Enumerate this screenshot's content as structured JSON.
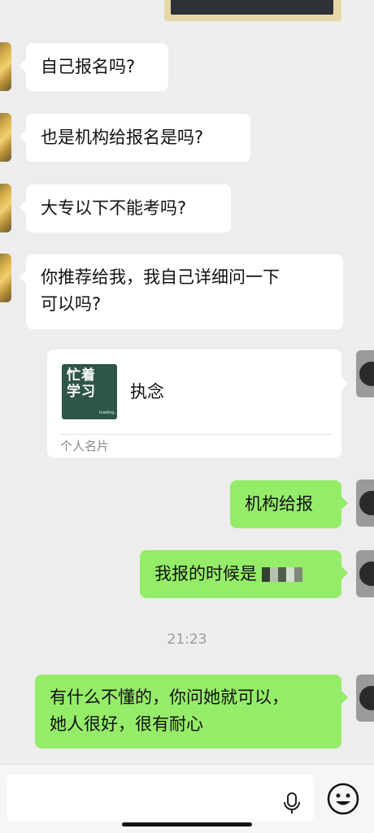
{
  "messages": {
    "m1": "自己报名吗?",
    "m2": "也是机构给报名是吗?",
    "m3": "大专以下不能考吗?",
    "m4_line1": "你推荐给我，我自己详细问一下",
    "m4_line2": "可以吗?",
    "m5": "机构给报",
    "m6": "我报的时候是",
    "m7_line1": "有什么不懂的，你问她就可以，",
    "m7_line2": "她人很好，很有耐心"
  },
  "card": {
    "thumb_text": "忙着学习",
    "thumb_small": "loading...",
    "name": "执念",
    "footer": "个人名片"
  },
  "timestamp": "21:23",
  "colors": {
    "background": "#ededed",
    "sent_bubble": "#95ec69",
    "received_bubble": "#ffffff"
  },
  "icons": {
    "mic": "microphone-icon",
    "emoji": "emoji-icon"
  }
}
